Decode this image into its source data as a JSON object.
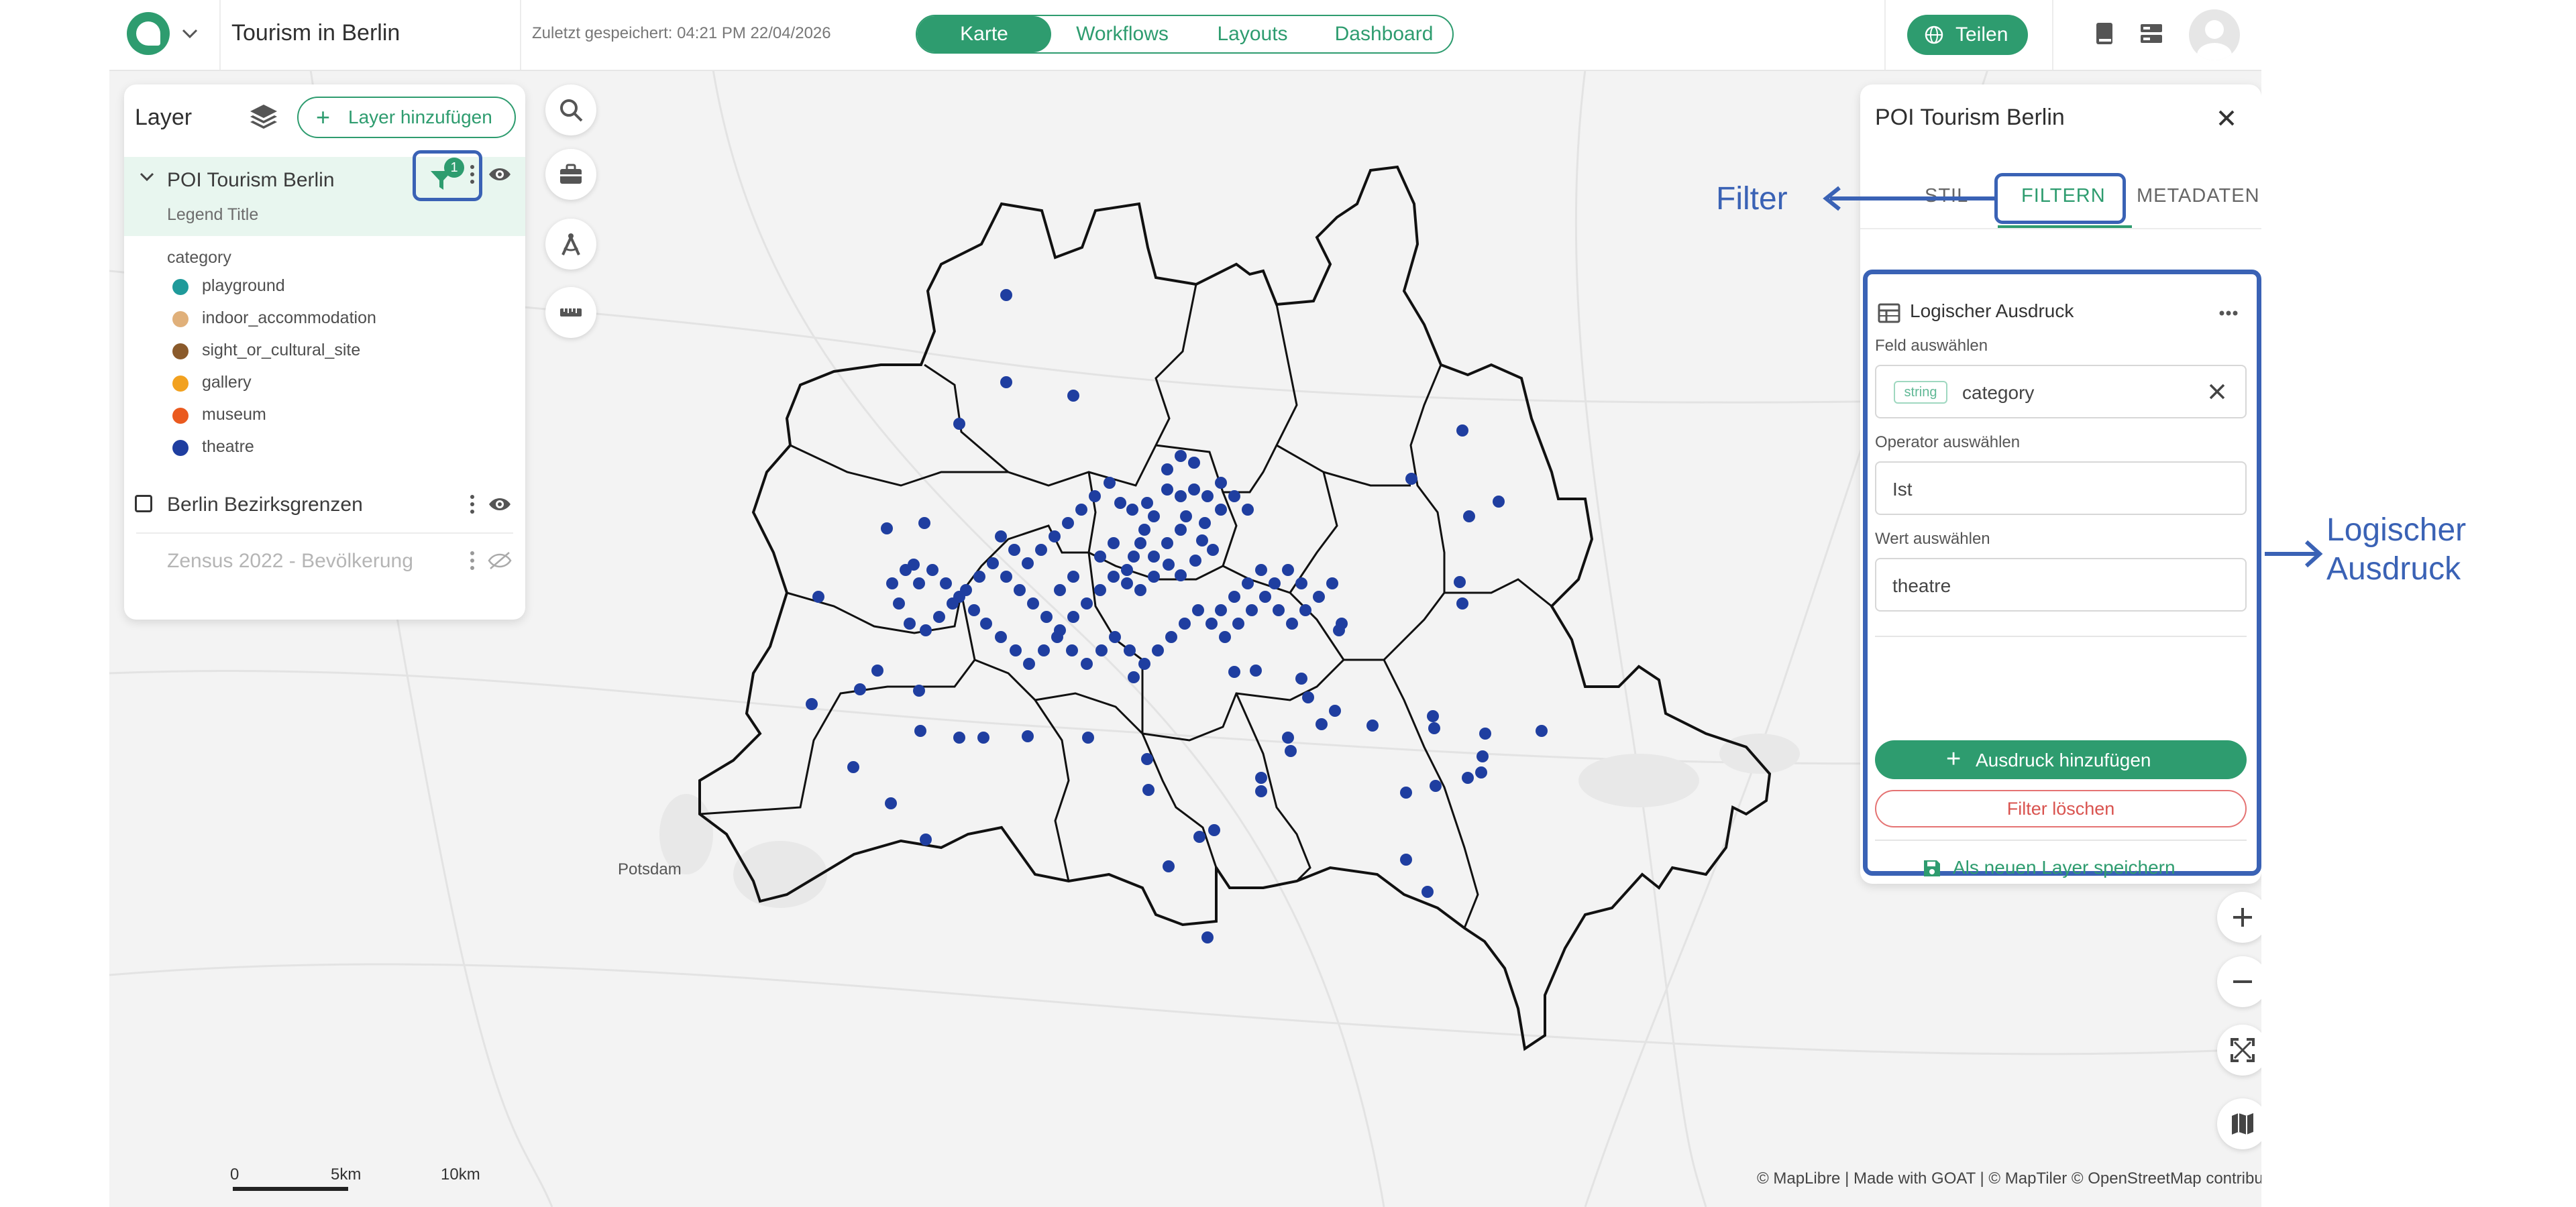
{
  "app": {
    "project_title": "Tourism in Berlin",
    "saved_status": "Zuletzt gespeichert: 04:21 PM 22/04/2026",
    "nav_tabs": [
      {
        "label": "Karte",
        "active": true
      },
      {
        "label": "Workflows",
        "active": false
      },
      {
        "label": "Layouts",
        "active": false
      },
      {
        "label": "Dashboard",
        "active": false
      }
    ],
    "share_label": "Teilen",
    "accent_color": "#2e9c6f",
    "highlight_color": "#3a62b5"
  },
  "layer_panel": {
    "title": "Layer",
    "add_layer_label": "Layer hinzufügen",
    "layers": [
      {
        "name": "POI Tourism Berlin",
        "legend_title": "Legend Title",
        "filter_count": "1",
        "legend_field": "category",
        "categories": [
          {
            "label": "playground",
            "color": "#1f9a9a"
          },
          {
            "label": "indoor_accommodation",
            "color": "#e0b07a"
          },
          {
            "label": "sight_or_cultural_site",
            "color": "#8a5a2b"
          },
          {
            "label": "gallery",
            "color": "#f2a11f"
          },
          {
            "label": "museum",
            "color": "#ea5a1f"
          },
          {
            "label": "theatre",
            "color": "#1f3ea0"
          }
        ]
      },
      {
        "name": "Berlin Bezirksgrenzen",
        "visible": true
      },
      {
        "name": "Zensus 2022 - Bevölkerung",
        "visible": false
      }
    ]
  },
  "map": {
    "place_label": "Potsdam",
    "scale_labels": [
      "0",
      "5km",
      "10km"
    ],
    "attribution": "© MapLibre | Made with GOAT | © MapTiler © OpenStreetMap contributors",
    "point_color": "#1f3ea0"
  },
  "filter_panel": {
    "title": "POI Tourism Berlin",
    "tabs": [
      {
        "label": "STIL",
        "active": false
      },
      {
        "label": "FILTERN",
        "active": true
      },
      {
        "label": "METADATEN",
        "active": false
      }
    ],
    "expression_title": "Logischer Ausdruck",
    "field_label": "Feld auswählen",
    "field_type": "string",
    "field_value": "category",
    "operator_label": "Operator auswählen",
    "operator_value": "Ist",
    "value_label": "Wert auswählen",
    "value_value": "theatre",
    "add_expression_label": "Ausdruck hinzufügen",
    "delete_filter_label": "Filter löschen",
    "save_as_layer_label": "Als neuen Layer speichern"
  },
  "callouts": {
    "filter": "Filter",
    "logical_expression_line1": "Logischer",
    "logical_expression_line2": "Ausdruck"
  }
}
